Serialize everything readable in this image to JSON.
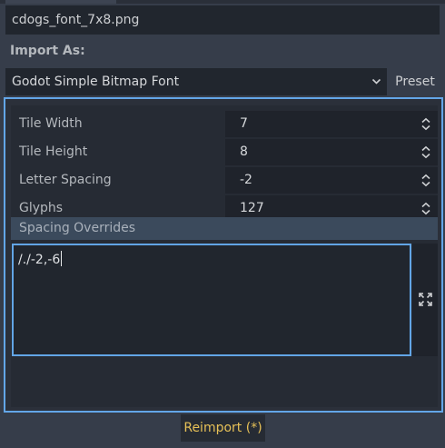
{
  "file": {
    "name": "cdogs_font_7x8.png"
  },
  "import": {
    "label": "Import As:",
    "selected": "Godot Simple Bitmap Font",
    "preset_label": "Preset"
  },
  "properties": [
    {
      "name": "Tile Width",
      "value": "7"
    },
    {
      "name": "Tile Height",
      "value": "8"
    },
    {
      "name": "Letter Spacing",
      "value": "-2"
    },
    {
      "name": "Glyphs",
      "value": "127"
    }
  ],
  "spacing_overrides": {
    "label": "Spacing Overrides",
    "text": "/./-2,-6"
  },
  "reimport": {
    "label": "Reimport (*)"
  },
  "colors": {
    "accent": "#63a6e8",
    "reimport_text": "#e6c057",
    "section_header": "#3b4a5c",
    "background": "#363d4a"
  },
  "icons": {
    "select": "chevron-down-icon",
    "spinner": "spinner-updown-icon",
    "expand": "expand-icon"
  }
}
